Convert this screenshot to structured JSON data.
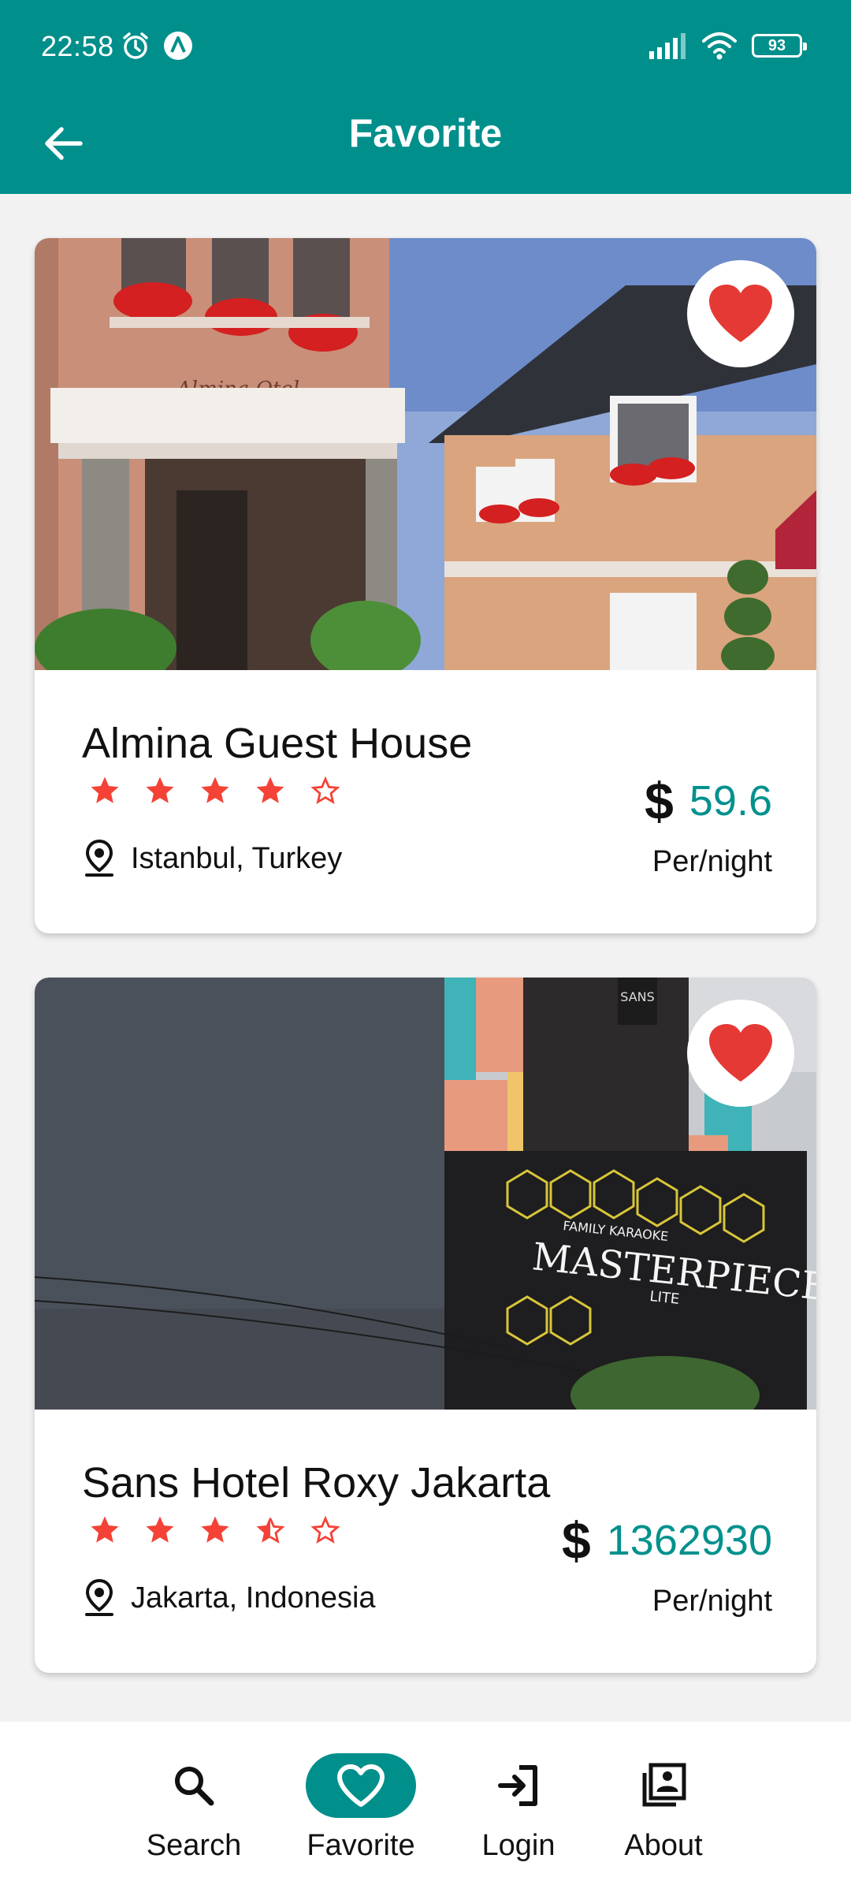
{
  "status": {
    "time": "22:58",
    "battery": "93"
  },
  "appbar": {
    "title": "Favorite"
  },
  "colors": {
    "primary": "#008f8b",
    "star": "#f44336",
    "heart": "#e53935",
    "price": "#00918d"
  },
  "hotels": [
    {
      "name": "Almina Guest House",
      "rating": 4,
      "location": "Istanbul, Turkey",
      "currency": "$",
      "price": "59.6",
      "per_night": "Per/night"
    },
    {
      "name": "Sans Hotel Roxy Jakarta",
      "rating": 3.5,
      "location": "Jakarta, Indonesia",
      "currency": "$",
      "price": "1362930",
      "per_night": "Per/night"
    }
  ],
  "nav": {
    "items": [
      {
        "label": "Search",
        "icon": "search-icon"
      },
      {
        "label": "Favorite",
        "icon": "heart-icon",
        "active": true
      },
      {
        "label": "Login",
        "icon": "login-icon"
      },
      {
        "label": "About",
        "icon": "about-icon"
      }
    ]
  },
  "image_text": {
    "sign1": "Almina Otel",
    "sign2_top": "FAMILY KARAOKE",
    "sign2_main": "MASTERPIECE",
    "sign2_sub": "LITE",
    "sign2_tower": "SANS"
  }
}
